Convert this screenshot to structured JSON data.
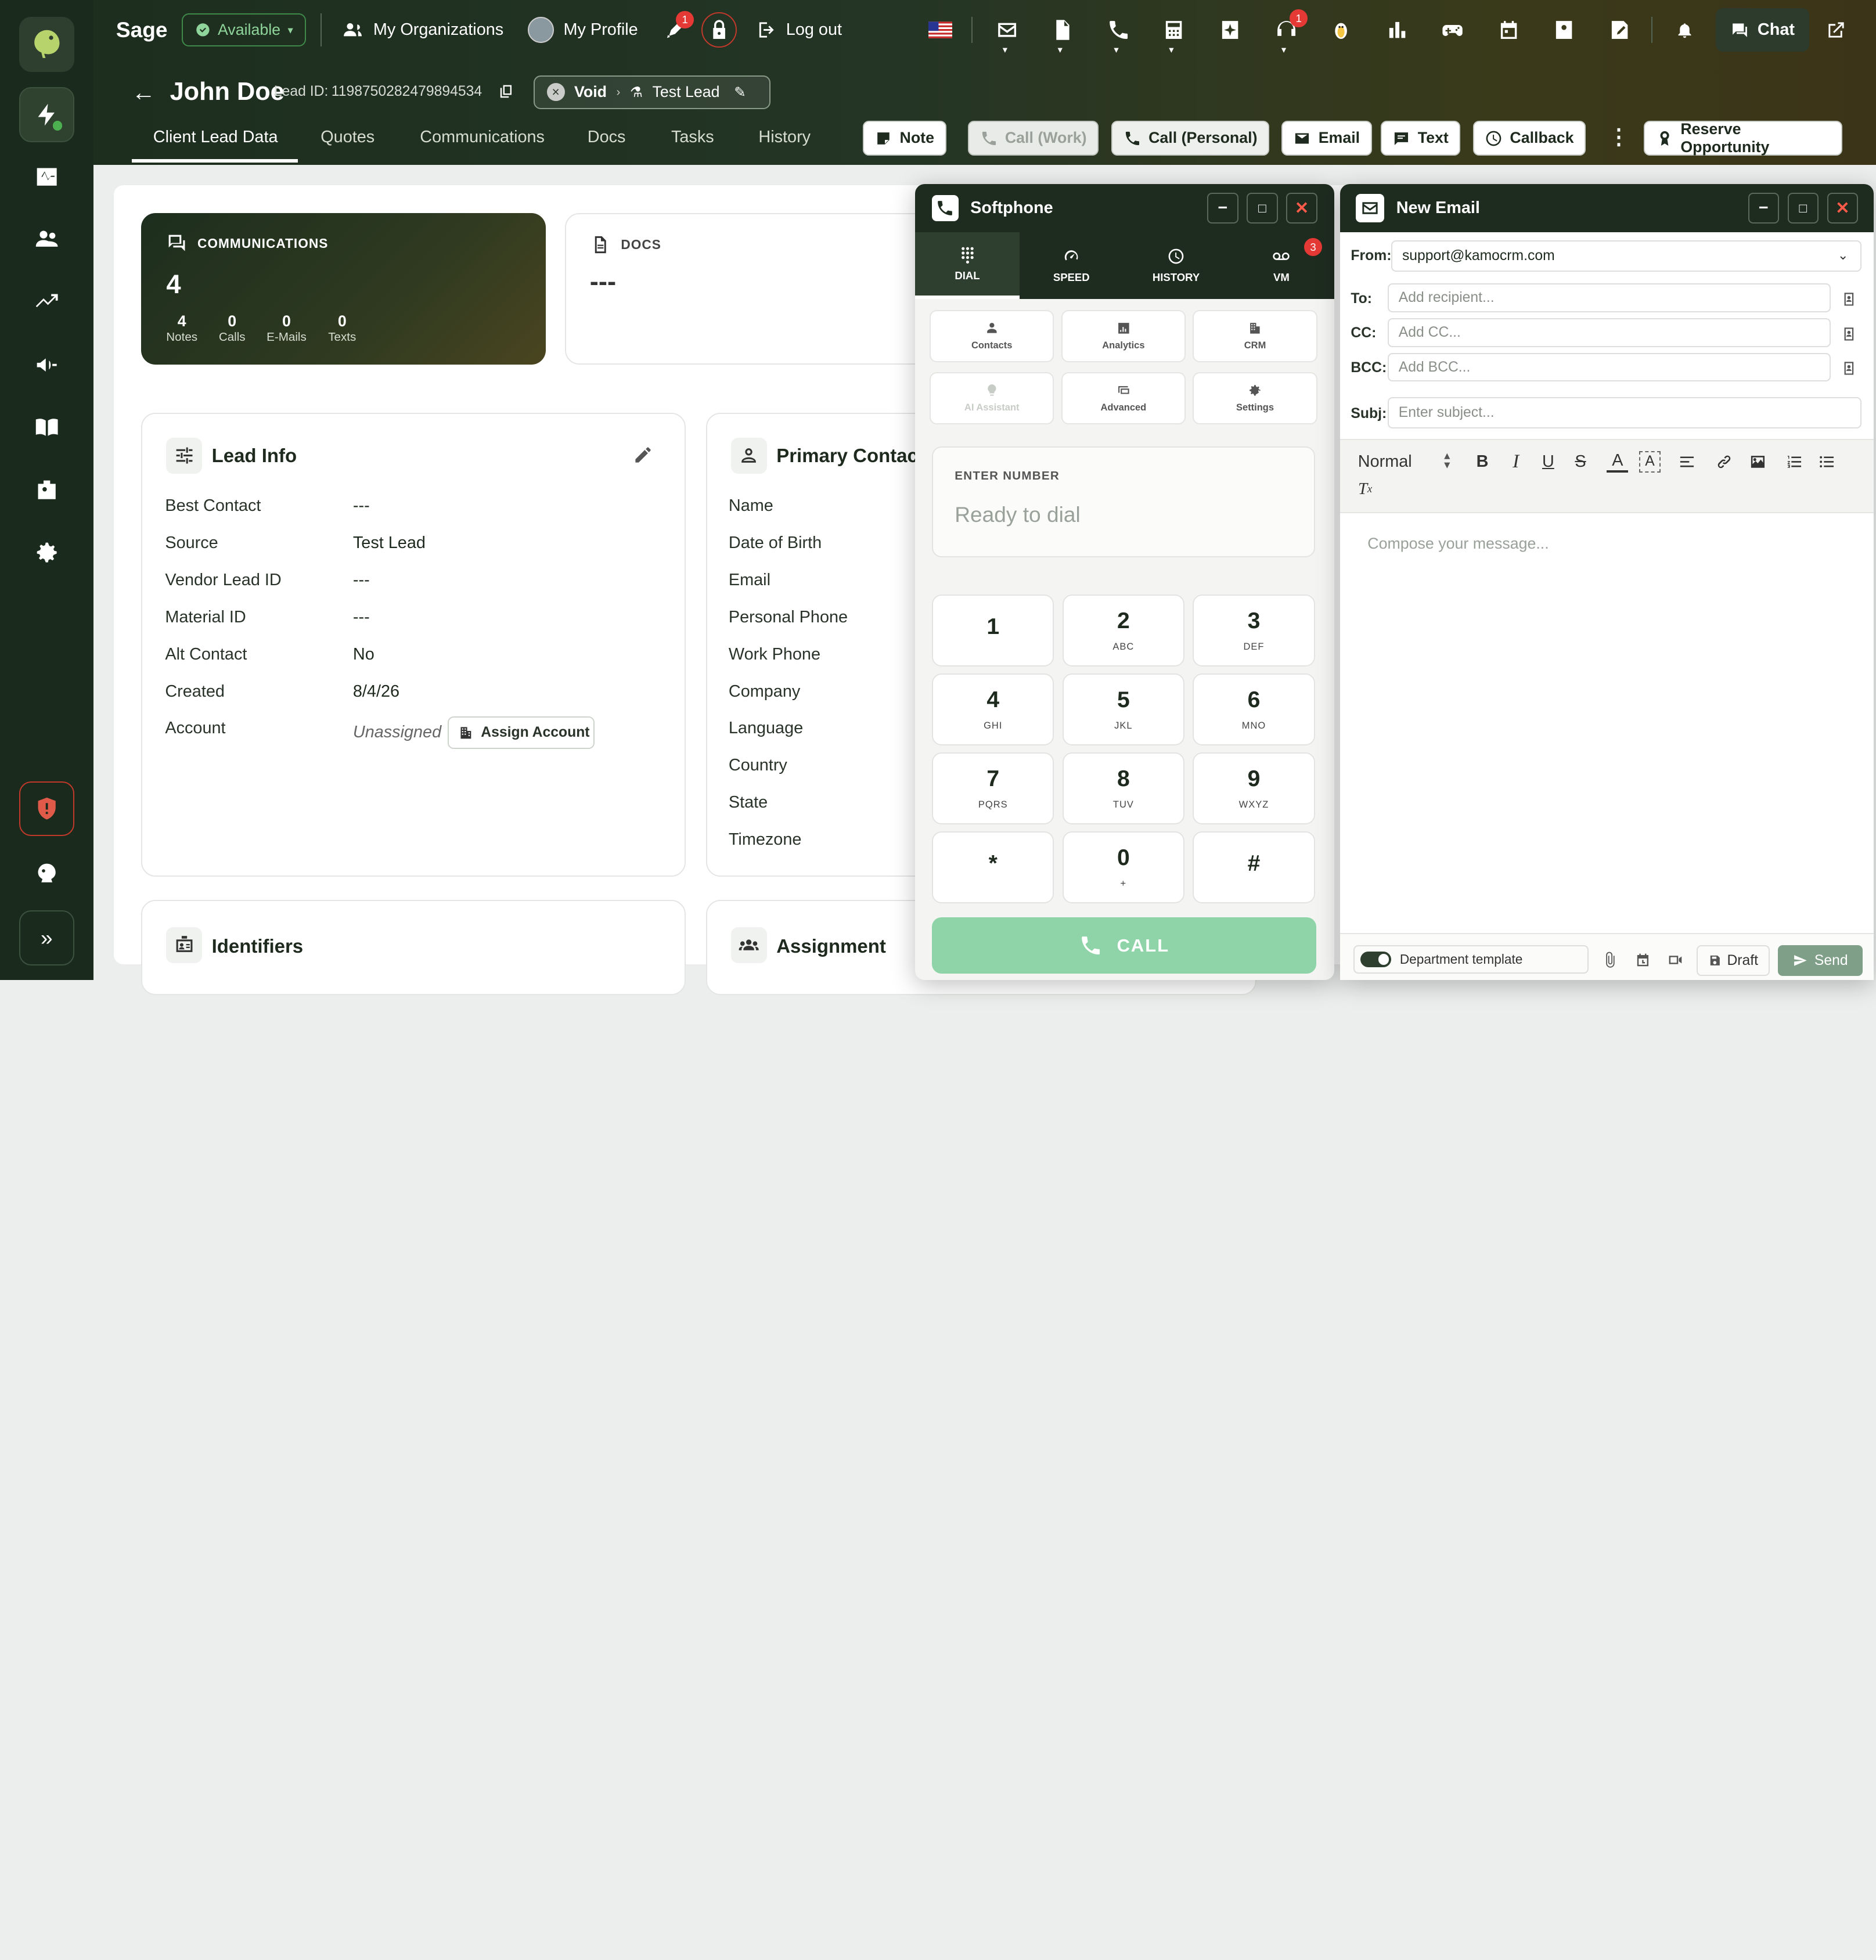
{
  "app": {
    "name": "Sage",
    "status": "Available"
  },
  "topnav": {
    "organizations": "My Organizations",
    "profile": "My Profile",
    "logout": "Log out",
    "chat": "Chat",
    "notif_badge_a": "1",
    "notif_badge_b": "1"
  },
  "lead": {
    "name": "John Doe",
    "lead_id_label": "Lead ID:",
    "lead_id": "1198750282479894534",
    "status_void": "Void",
    "status_test": "Test Lead"
  },
  "tabs": [
    "Client Lead Data",
    "Quotes",
    "Communications",
    "Docs",
    "Tasks",
    "History"
  ],
  "actions": {
    "note": "Note",
    "call_work": "Call (Work)",
    "call_personal": "Call (Personal)",
    "email": "Email",
    "text": "Text",
    "callback": "Callback",
    "reserve": "Reserve Opportunity"
  },
  "communications": {
    "title": "COMMUNICATIONS",
    "total": "4",
    "stats": [
      {
        "value": "4",
        "label": "Notes"
      },
      {
        "value": "0",
        "label": "Calls"
      },
      {
        "value": "0",
        "label": "E-Mails"
      },
      {
        "value": "0",
        "label": "Texts"
      }
    ]
  },
  "docs": {
    "title": "DOCS",
    "value": "---"
  },
  "lead_info": {
    "title": "Lead Info",
    "rows": [
      {
        "label": "Best Contact",
        "value": "---"
      },
      {
        "label": "Source",
        "value": "Test Lead"
      },
      {
        "label": "Vendor Lead ID",
        "value": "---"
      },
      {
        "label": "Material ID",
        "value": "---"
      },
      {
        "label": "Alt Contact",
        "value": "No"
      },
      {
        "label": "Created",
        "value": "8/4/26"
      },
      {
        "label": "Account",
        "value": "Unassigned"
      }
    ],
    "assign_button": "Assign Account"
  },
  "primary_contact": {
    "title": "Primary Contact",
    "labels": [
      "Name",
      "Date of Birth",
      "Email",
      "Personal Phone",
      "Work Phone",
      "Company",
      "Language",
      "Country",
      "State",
      "Timezone"
    ]
  },
  "identifiers": {
    "title": "Identifiers"
  },
  "assignment": {
    "title": "Assignment"
  },
  "softphone": {
    "title": "Softphone",
    "tabs": [
      {
        "label": "DIAL",
        "icon": "dialpad-icon"
      },
      {
        "label": "SPEED",
        "icon": "speedometer-icon"
      },
      {
        "label": "HISTORY",
        "icon": "clock-icon"
      },
      {
        "label": "VM",
        "icon": "voicemail-icon"
      }
    ],
    "vm_badge": "3",
    "tools": [
      "Contacts",
      "Analytics",
      "CRM",
      "AI Assistant",
      "Advanced",
      "Settings"
    ],
    "enter_number_label": "ENTER NUMBER",
    "enter_number_placeholder": "Ready to dial",
    "keys": [
      {
        "n": "1",
        "s": ""
      },
      {
        "n": "2",
        "s": "ABC"
      },
      {
        "n": "3",
        "s": "DEF"
      },
      {
        "n": "4",
        "s": "GHI"
      },
      {
        "n": "5",
        "s": "JKL"
      },
      {
        "n": "6",
        "s": "MNO"
      },
      {
        "n": "7",
        "s": "PQRS"
      },
      {
        "n": "8",
        "s": "TUV"
      },
      {
        "n": "9",
        "s": "WXYZ"
      },
      {
        "n": "*",
        "s": ""
      },
      {
        "n": "0",
        "s": "+"
      },
      {
        "n": "#",
        "s": ""
      }
    ],
    "call_button": "CALL"
  },
  "email": {
    "title": "New Email",
    "from_label": "From:",
    "from_value": "support@kamocrm.com",
    "to_label": "To:",
    "to_placeholder": "Add recipient...",
    "cc_label": "CC:",
    "cc_placeholder": "Add CC...",
    "bcc_label": "BCC:",
    "bcc_placeholder": "Add BCC...",
    "subj_label": "Subj:",
    "subj_placeholder": "Enter subject...",
    "format_select": "Normal",
    "body_placeholder": "Compose your message...",
    "template_toggle": "Department template",
    "draft": "Draft",
    "send": "Send"
  },
  "colors": {
    "brand_dark": "#1a2a1c",
    "call_green": "#8fd4a8",
    "send_green": "#7f9f88",
    "alert_red": "#e53935"
  }
}
